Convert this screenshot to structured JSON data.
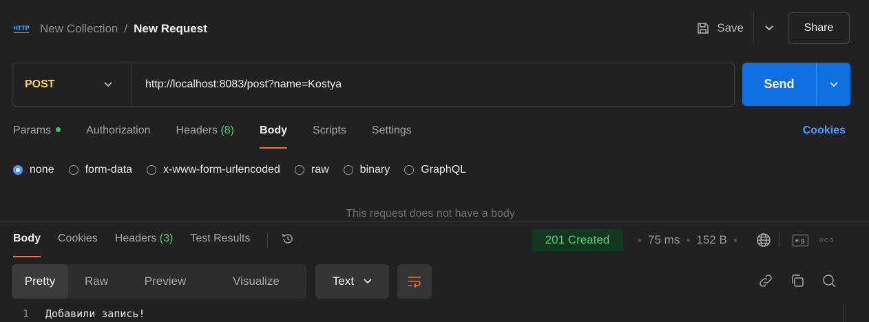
{
  "header": {
    "collection": "New Collection",
    "separator": "/",
    "request_name": "New Request",
    "save_label": "Save",
    "share_label": "Share"
  },
  "request": {
    "method": "POST",
    "url": "http://localhost:8083/post?name=Kostya",
    "send_label": "Send"
  },
  "request_tabs": {
    "params": "Params",
    "authorization": "Authorization",
    "headers": "Headers",
    "headers_count": "(8)",
    "body": "Body",
    "scripts": "Scripts",
    "settings": "Settings",
    "cookies": "Cookies",
    "active": "Body"
  },
  "body_types": {
    "options": [
      "none",
      "form-data",
      "x-www-form-urlencoded",
      "raw",
      "binary",
      "GraphQL"
    ],
    "selected": "none",
    "empty_message": "This request does not have a body"
  },
  "response": {
    "tabs": {
      "body": "Body",
      "cookies": "Cookies",
      "headers": "Headers",
      "headers_count": "(3)",
      "test_results": "Test Results"
    },
    "status": "201 Created",
    "time": "75 ms",
    "size": "152 B",
    "example_badge": "e.g.",
    "more": "○○○",
    "views": [
      "Pretty",
      "Raw",
      "Preview",
      "Visualize"
    ],
    "active_view": "Pretty",
    "format": "Text",
    "lines": [
      {
        "number": "1",
        "text": "Добавили запись!"
      }
    ]
  },
  "colors": {
    "accent_orange": "#ff6c37",
    "send_blue": "#0d6fe0",
    "link_blue": "#4a9cff",
    "method_yellow": "#f7d64a",
    "success_green": "#4cd07d"
  }
}
